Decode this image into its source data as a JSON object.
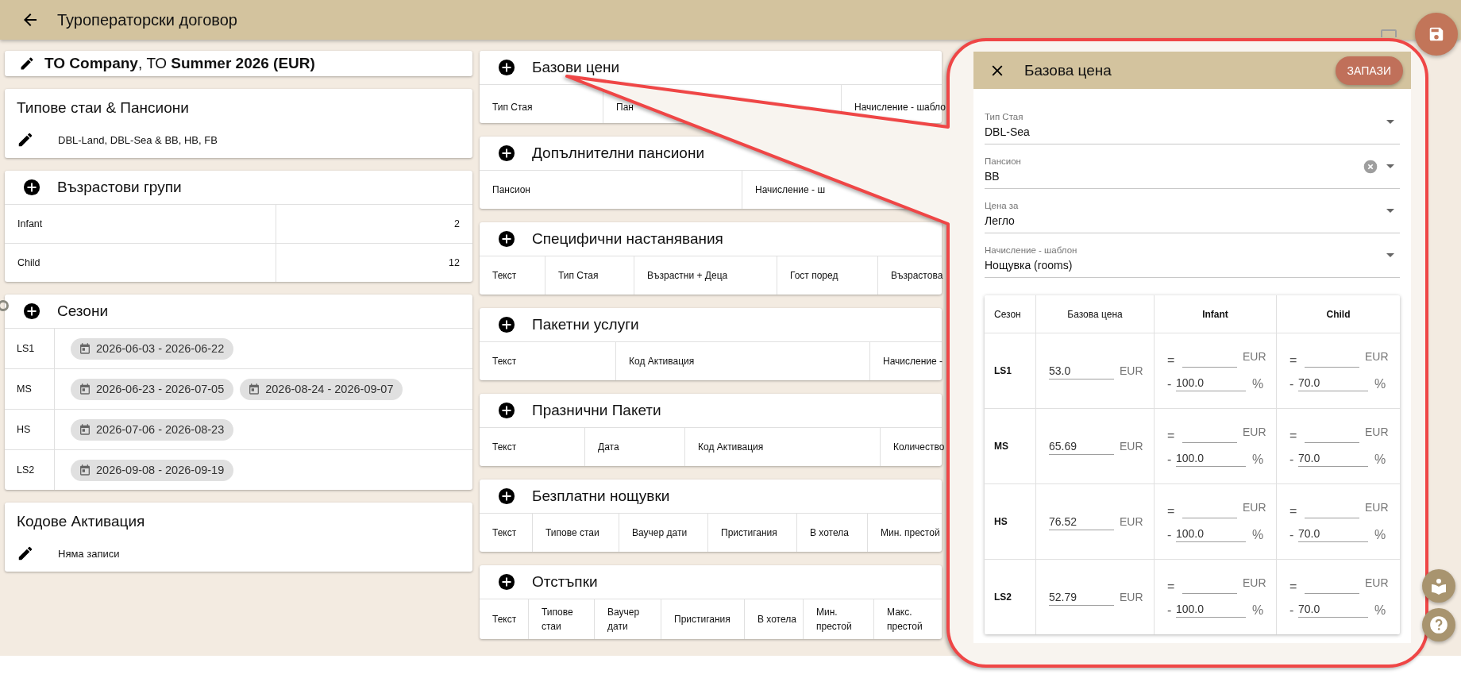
{
  "app_bar": {
    "title": "Туроператорски договор"
  },
  "contract": {
    "title": "**TO Company**, ТО **Summer 2026 (EUR)**"
  },
  "room_types": {
    "title": "Типове стаи & Пансиони",
    "summary": "DBL-Land, DBL-Sea & BB, HB, FB"
  },
  "age_groups": {
    "title": "Възрастови групи",
    "rows": [
      {
        "name": "Infant",
        "value": "2"
      },
      {
        "name": "Child",
        "value": "12"
      }
    ]
  },
  "seasons": {
    "title": "Сезони",
    "rows": [
      {
        "code": "LS1",
        "periods": [
          "2026-06-03 - 2026-06-22"
        ]
      },
      {
        "code": "MS",
        "periods": [
          "2026-06-23 - 2026-07-05",
          "2026-08-24 - 2026-09-07"
        ]
      },
      {
        "code": "HS",
        "periods": [
          "2026-07-06 - 2026-08-23"
        ]
      },
      {
        "code": "LS2",
        "periods": [
          "2026-09-08 - 2026-09-19"
        ]
      }
    ]
  },
  "activation_codes": {
    "title": "Кодове Активация",
    "summary": "Няма записи"
  },
  "sections": [
    {
      "title": "Базови цени",
      "columns": [
        "Тип Стая",
        "Пан",
        "Начисление - шабло"
      ]
    },
    {
      "title": "Допълнителни пансиони",
      "columns": [
        "Пансион",
        "Начисление - ш"
      ]
    },
    {
      "title": "Специфични настанявания",
      "columns": [
        "Текст",
        "Тип Стая",
        "Възрастни + Деца",
        "Гост поред",
        "Възрастова"
      ]
    },
    {
      "title": "Пакетни услуги",
      "columns": [
        "Текст",
        "Код Активация",
        "Начисление -"
      ]
    },
    {
      "title": "Празнични Пакети",
      "columns": [
        "Текст",
        "Дата",
        "Код Активация",
        "Количество"
      ]
    },
    {
      "title": "Безплатни нощувки",
      "columns": [
        "Текст",
        "Типове стаи",
        "Ваучер дати",
        "Пристигания",
        "В хотела",
        "Мин. престой"
      ]
    },
    {
      "title": "Отстъпки",
      "columns": [
        "Текст",
        "Типове стаи",
        "Ваучер дати",
        "Пристигания",
        "В хотела",
        "Мин. престой",
        "Макс. престой"
      ]
    }
  ],
  "dialog": {
    "title": "Базова цена",
    "save_label": "ЗАПАЗИ",
    "fields": [
      {
        "label": "Тип Стая",
        "value": "DBL-Sea",
        "clearable": false
      },
      {
        "label": "Пансион",
        "value": "BB",
        "clearable": true
      },
      {
        "label": "Цена за",
        "value": "Легло",
        "clearable": false
      },
      {
        "label": "Начисление - шаблон",
        "value": "Нощувка (rooms)",
        "clearable": false
      }
    ],
    "price_table": {
      "columns": [
        "Сезон",
        "Базова цена",
        "Infant",
        "Child"
      ],
      "rows": [
        {
          "season": "LS1",
          "base": {
            "value": "53.0",
            "currency": "EUR"
          },
          "infant": {
            "equals": "=",
            "currency": "EUR",
            "minus": "-",
            "value": "100.0",
            "unit": "%"
          },
          "child": {
            "equals": "=",
            "currency": "EUR",
            "minus": "-",
            "value": "70.0",
            "unit": "%"
          }
        },
        {
          "season": "MS",
          "base": {
            "value": "65.69",
            "currency": "EUR"
          },
          "infant": {
            "equals": "=",
            "currency": "EUR",
            "minus": "-",
            "value": "100.0",
            "unit": "%"
          },
          "child": {
            "equals": "=",
            "currency": "EUR",
            "minus": "-",
            "value": "70.0",
            "unit": "%"
          }
        },
        {
          "season": "HS",
          "base": {
            "value": "76.52",
            "currency": "EUR"
          },
          "infant": {
            "equals": "=",
            "currency": "EUR",
            "minus": "-",
            "value": "100.0",
            "unit": "%"
          },
          "child": {
            "equals": "=",
            "currency": "EUR",
            "minus": "-",
            "value": "70.0",
            "unit": "%"
          }
        },
        {
          "season": "LS2",
          "base": {
            "value": "52.79",
            "currency": "EUR"
          },
          "infant": {
            "equals": "=",
            "currency": "EUR",
            "minus": "-",
            "value": "100.0",
            "unit": "%"
          },
          "child": {
            "equals": "=",
            "currency": "EUR",
            "minus": "-",
            "value": "70.0",
            "unit": "%"
          }
        }
      ]
    }
  }
}
